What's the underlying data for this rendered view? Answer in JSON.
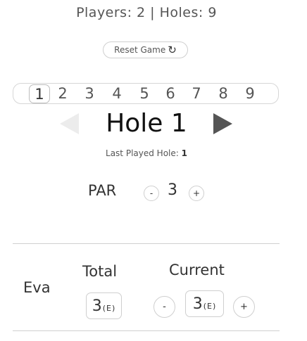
{
  "summary": {
    "players_label": "Players: ",
    "players_value": "2",
    "separator": " | ",
    "holes_label": "Holes: ",
    "holes_value": "9"
  },
  "reset": {
    "label": "Reset Game",
    "icon": "↻",
    "icon_name": "refresh-icon"
  },
  "holes": {
    "items": [
      "1",
      "2",
      "3",
      "4",
      "5",
      "6",
      "7",
      "8",
      "9"
    ],
    "active": "1"
  },
  "current_hole": {
    "title": "Hole 1",
    "last_played_label": "Last Played Hole: ",
    "last_played_value": "1"
  },
  "par": {
    "label": "PAR",
    "minus": "-",
    "value": "3",
    "plus": "+"
  },
  "scoreboard": {
    "total_header": "Total",
    "current_header": "Current",
    "players": [
      {
        "name": "Eva",
        "total": "3",
        "total_rel": "(E)",
        "current": "3",
        "current_rel": "(E)",
        "minus": "-",
        "plus": "+"
      }
    ]
  },
  "colors": {
    "text": "#333333",
    "border": "#cfcfcf",
    "arrow_disabled": "#ececec",
    "arrow_enabled": "#555555"
  }
}
